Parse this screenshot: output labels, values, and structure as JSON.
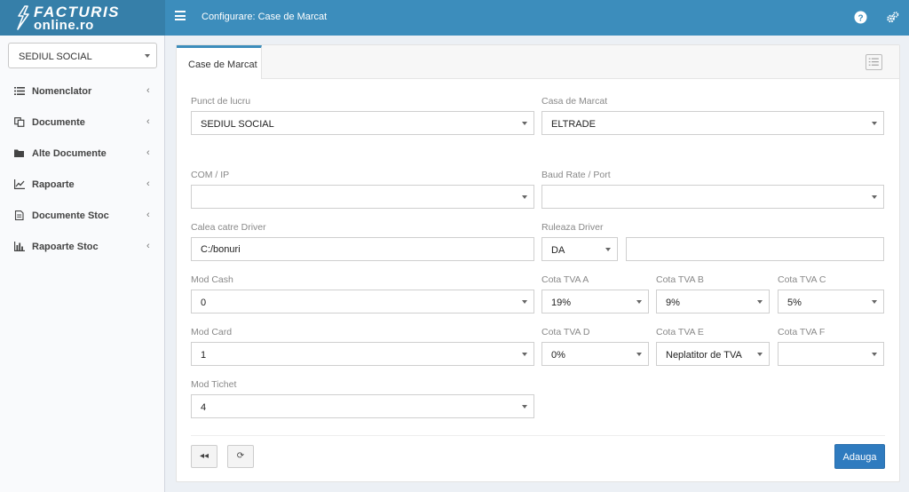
{
  "header": {
    "brand_line1": "FACTURIS",
    "brand_line2": "online.ro",
    "page_title": "Configurare: Case de Marcat",
    "colors": {
      "bar": "#3c8dbc",
      "logo_bg": "#367fa9"
    },
    "icons": [
      "help-icon",
      "settings-icon"
    ]
  },
  "sidebar": {
    "location_select": {
      "value": "SEDIUL SOCIAL"
    },
    "items": [
      {
        "label": "Nomenclator",
        "icon": "list-icon"
      },
      {
        "label": "Documente",
        "icon": "copy-icon"
      },
      {
        "label": "Alte Documente",
        "icon": "folder-icon"
      },
      {
        "label": "Rapoarte",
        "icon": "line-chart-icon"
      },
      {
        "label": "Documente Stoc",
        "icon": "document-icon"
      },
      {
        "label": "Rapoarte Stoc",
        "icon": "bar-chart-icon"
      }
    ],
    "chevron": "‹"
  },
  "tab": {
    "label": "Case de Marcat"
  },
  "form": {
    "punct_de_lucru": {
      "label": "Punct de lucru",
      "value": "SEDIUL SOCIAL"
    },
    "casa_de_marcat": {
      "label": "Casa de Marcat",
      "value": "ELTRADE"
    },
    "com_ip": {
      "label": "COM / IP",
      "value": ""
    },
    "baud_rate": {
      "label": "Baud Rate / Port",
      "value": ""
    },
    "calea_driver": {
      "label": "Calea catre Driver",
      "value": "C:/bonuri"
    },
    "ruleaza_driver": {
      "label": "Ruleaza Driver",
      "value": "DA",
      "extra_value": ""
    },
    "mod_cash": {
      "label": "Mod Cash",
      "value": "0"
    },
    "cota_tva_a": {
      "label": "Cota TVA A",
      "value": "19%"
    },
    "cota_tva_b": {
      "label": "Cota TVA B",
      "value": "9%"
    },
    "cota_tva_c": {
      "label": "Cota TVA C",
      "value": "5%"
    },
    "mod_card": {
      "label": "Mod Card",
      "value": "1"
    },
    "cota_tva_d": {
      "label": "Cota TVA D",
      "value": "0%"
    },
    "cota_tva_e": {
      "label": "Cota TVA E",
      "value": "Neplatitor de TVA"
    },
    "cota_tva_f": {
      "label": "Cota TVA F",
      "value": ""
    },
    "mod_tichet": {
      "label": "Mod Tichet",
      "value": "4"
    }
  },
  "actions": {
    "back_glyph": "◂◂",
    "refresh_glyph": "⟳",
    "add_label": "Adauga",
    "primary_color": "#2f7bbf"
  }
}
